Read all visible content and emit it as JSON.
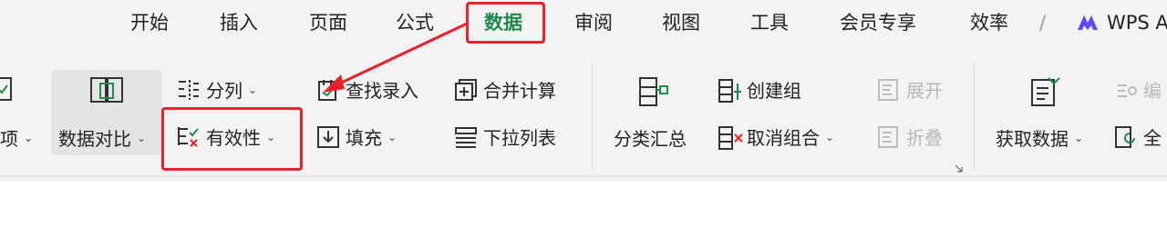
{
  "tabs": [
    {
      "id": "home",
      "label": "开始"
    },
    {
      "id": "insert",
      "label": "插入"
    },
    {
      "id": "layout",
      "label": "页面"
    },
    {
      "id": "formula",
      "label": "公式"
    },
    {
      "id": "data",
      "label": "数据",
      "active": true
    },
    {
      "id": "review",
      "label": "审阅"
    },
    {
      "id": "view",
      "label": "视图"
    },
    {
      "id": "tools",
      "label": "工具"
    },
    {
      "id": "member",
      "label": "会员专享"
    },
    {
      "id": "efficiency",
      "label": "效率"
    }
  ],
  "wps_ai_label": "WPS A",
  "ribbon": {
    "partial_item": "项",
    "data_compare": "数据对比",
    "split_column": "分列",
    "validity": "有效性",
    "lookup_entry": "查找录入",
    "fill": "填充",
    "consolidate": "合并计算",
    "dropdown_list": "下拉列表",
    "subtotal": "分类汇总",
    "create_group": "创建组",
    "ungroup": "取消组合",
    "expand": "展开",
    "collapse": "折叠",
    "get_data": "获取数据",
    "edit_partial": "编",
    "full_partial": "全"
  },
  "colors": {
    "accent_green": "#1f8a4c",
    "annotation_red": "#e8212b",
    "ribbon_bg": "#f3f3f4"
  }
}
